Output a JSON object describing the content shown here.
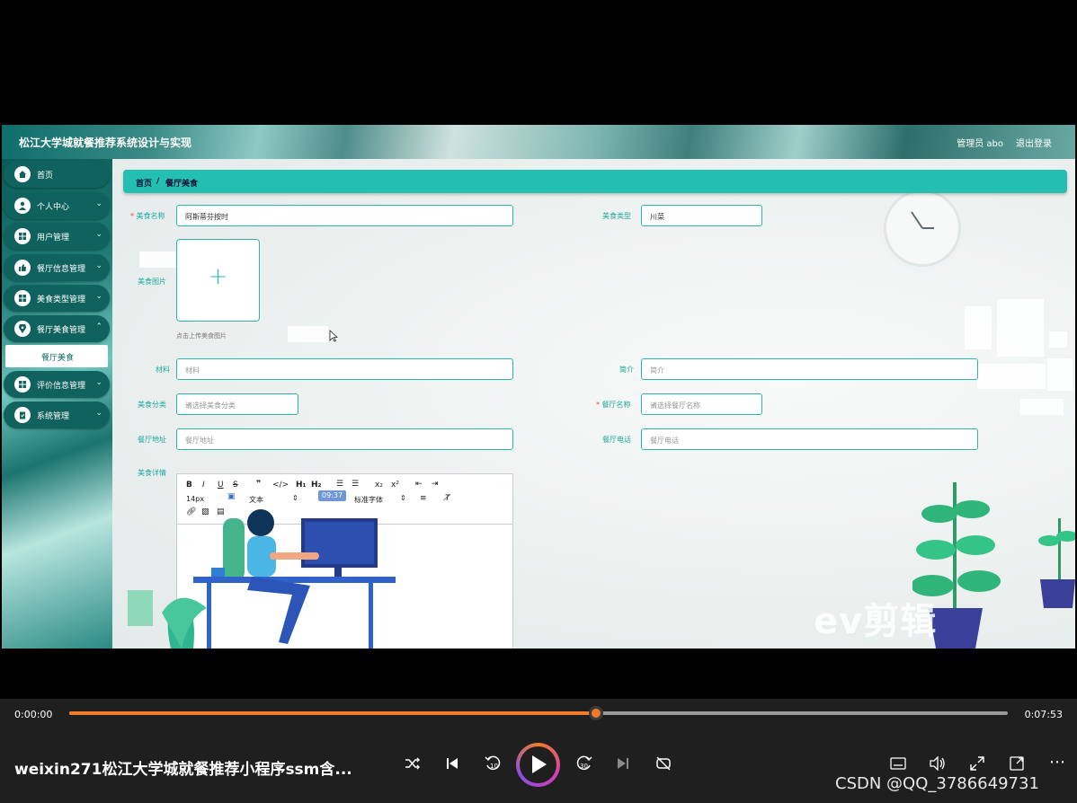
{
  "app": {
    "title": "松江大学城就餐推荐系统设计与实现",
    "user_label": "管理员 abo",
    "logout_label": "退出登录"
  },
  "sidebar": {
    "items": [
      {
        "label": "首页",
        "icon": "home-icon"
      },
      {
        "label": "个人中心",
        "icon": "user-icon"
      },
      {
        "label": "用户管理",
        "icon": "grid-icon"
      },
      {
        "label": "餐厅信息管理",
        "icon": "thumb-icon"
      },
      {
        "label": "美食类型管理",
        "icon": "grid-icon"
      },
      {
        "label": "餐厅美食管理",
        "icon": "location-icon"
      },
      {
        "label": "评价信息管理",
        "icon": "grid-icon"
      },
      {
        "label": "系统管理",
        "icon": "clipboard-icon"
      }
    ],
    "submenu_active": "餐厅美食"
  },
  "breadcrumb": {
    "home": "首页",
    "sep": "/",
    "current": "餐厅美食"
  },
  "form": {
    "food_name": {
      "label": "美食名称",
      "value": "阿斯蒂芬按时"
    },
    "food_type": {
      "label": "美食类型",
      "value": "川菜"
    },
    "food_image": {
      "label": "美食图片",
      "hint": "点击上传美食图片"
    },
    "ingredients": {
      "label": "材料",
      "placeholder": "材料"
    },
    "intro": {
      "label": "简介",
      "placeholder": "简介"
    },
    "category": {
      "label": "美食分类",
      "placeholder": "请选择美食分类"
    },
    "restaurant": {
      "label": "餐厅名称",
      "placeholder": "请选择餐厅名称"
    },
    "address": {
      "label": "餐厅地址",
      "placeholder": "餐厅地址"
    },
    "phone": {
      "label": "餐厅电话",
      "placeholder": "餐厅电话"
    },
    "details": {
      "label": "美食详情"
    }
  },
  "editor": {
    "font_size": "14px",
    "text_style": "文本",
    "font_family": "标准字体",
    "time_badge": "09:37"
  },
  "player": {
    "current_time": "0:00:00",
    "total_time": "0:07:53",
    "progress": 0.561,
    "video_title": "weixin271松江大学城就餐推荐小程序ssm含...",
    "watermark": "CSDN @QQ_3786649731",
    "overlay_logo": "ev剪辑",
    "accent": "#f07a2a"
  }
}
